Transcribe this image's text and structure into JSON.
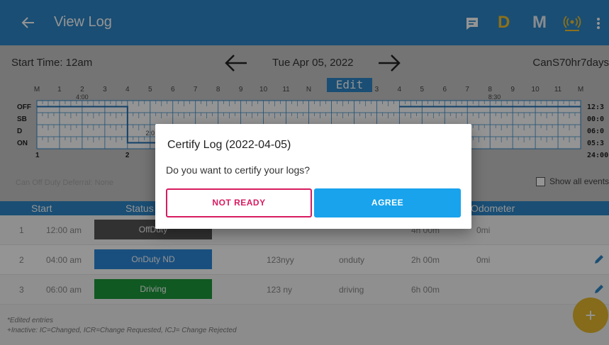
{
  "appbar": {
    "title": "View Log",
    "icons": [
      "back-arrow-icon",
      "message-icon",
      "d-mode-icon",
      "m-mode-icon",
      "signal-icon",
      "overflow-menu-icon"
    ],
    "d_label": "D",
    "m_label": "M",
    "d_color": "#f2c230",
    "m_color": "#e8f0f8",
    "bg_color": "#2e87c8"
  },
  "date_bar": {
    "start_time": "Start Time: 12am",
    "date": "Tue Apr 05, 2022",
    "cycle": "CanS70hr7days"
  },
  "graph": {
    "edit_label": "Edit",
    "row_labels": [
      "OFF",
      "SB",
      "D",
      "ON"
    ],
    "hour_labels": [
      "M",
      "1",
      "2",
      "3",
      "4",
      "5",
      "6",
      "7",
      "8",
      "9",
      "10",
      "11",
      "N",
      "1",
      "2",
      "3",
      "4",
      "5",
      "6",
      "7",
      "8",
      "9",
      "10",
      "11",
      "M"
    ],
    "duration_labels": [
      "4:00",
      "8:30",
      "2:0"
    ],
    "bottom_labels": [
      "1",
      "2"
    ],
    "totals": [
      "12:3",
      "00:0",
      "06:0",
      "05:3",
      "24:00"
    ]
  },
  "deferral": "Can Off Duty Deferral: None",
  "show_all_events": "Show all events",
  "table": {
    "headers": {
      "start": "Start",
      "status": "Status",
      "odometer": "Odometer"
    },
    "rows": [
      {
        "num": "1",
        "start": "12:00 am",
        "status": "OffDuty",
        "status_color": "#555555",
        "location": "",
        "note": "",
        "duration": "4h 00m",
        "odometer": "0mi",
        "editable": false
      },
      {
        "num": "2",
        "start": "04:00 am",
        "status": "OnDuty ND",
        "status_color": "#2c88d9",
        "location": "123nyy",
        "note": "onduty",
        "duration": "2h 00m",
        "odometer": "0mi",
        "editable": true
      },
      {
        "num": "3",
        "start": "06:00 am",
        "status": "Driving",
        "status_color": "#1d9a3c",
        "location": "123 ny",
        "note": "driving",
        "duration": "6h 00m",
        "odometer": "",
        "editable": true
      }
    ]
  },
  "notes": {
    "line1": "*Edited entries",
    "line2": "+Inactive: IC=Changed, ICR=Change Requested, ICJ= Change Rejected"
  },
  "fab_label": "+",
  "dialog": {
    "title": "Certify Log (2022-04-05)",
    "message": "Do you want to certify your logs?",
    "not_ready": "NOT READY",
    "agree": "AGREE"
  }
}
